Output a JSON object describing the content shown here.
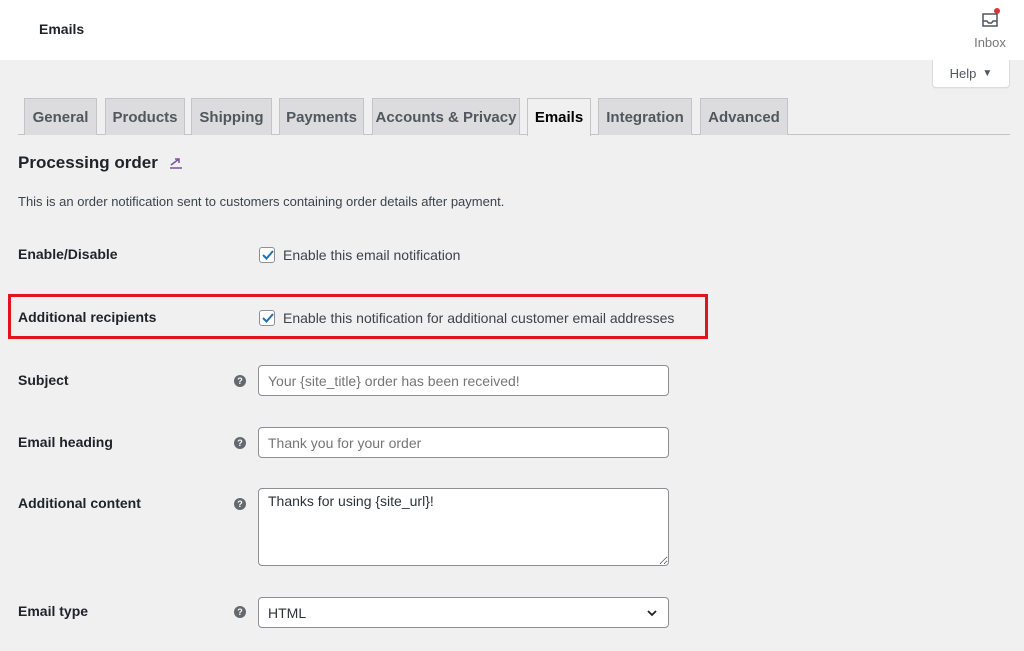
{
  "header": {
    "title": "Emails",
    "inbox_label": "Inbox"
  },
  "help": {
    "label": "Help"
  },
  "tabs": [
    {
      "label": "General"
    },
    {
      "label": "Products"
    },
    {
      "label": "Shipping"
    },
    {
      "label": "Payments"
    },
    {
      "label": "Accounts & Privacy"
    },
    {
      "label": "Emails",
      "active": true
    },
    {
      "label": "Integration"
    },
    {
      "label": "Advanced"
    }
  ],
  "section": {
    "title": "Processing order",
    "description": "This is an order notification sent to customers containing order details after payment."
  },
  "form": {
    "enable": {
      "label": "Enable/Disable",
      "checkbox_label": "Enable this email notification",
      "checked": true
    },
    "additional_recipients": {
      "label": "Additional recipients",
      "checkbox_label": "Enable this notification for additional customer email addresses",
      "checked": true
    },
    "subject": {
      "label": "Subject",
      "placeholder": "Your {site_title} order has been received!",
      "value": ""
    },
    "email_heading": {
      "label": "Email heading",
      "placeholder": "Thank you for your order",
      "value": ""
    },
    "additional_content": {
      "label": "Additional content",
      "value": "Thanks for using {site_url}!"
    },
    "email_type": {
      "label": "Email type",
      "selected": "HTML"
    }
  },
  "colors": {
    "accent": "#2271b1",
    "highlight_border": "#e0141e",
    "notification_dot": "#d63638",
    "link_icon": "#7b50a0"
  }
}
